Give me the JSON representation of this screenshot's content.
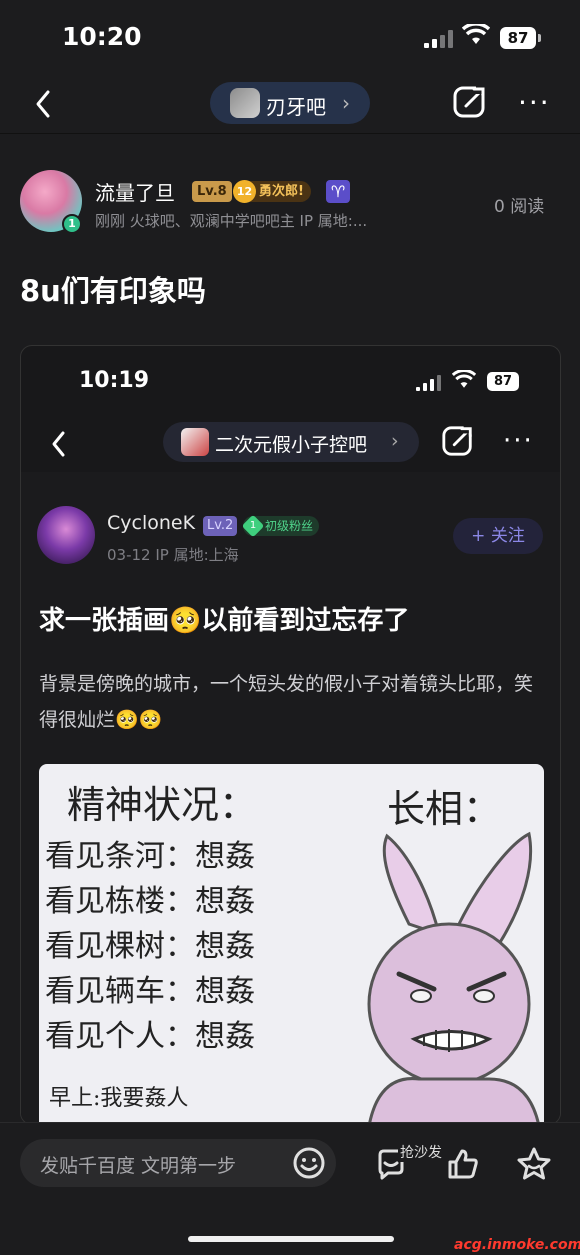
{
  "status_bar": {
    "time": "10:20",
    "battery": "87"
  },
  "nav": {
    "forum_name": "刃牙吧",
    "chevron": "›"
  },
  "author": {
    "name": "流量了旦",
    "level": "Lv.8",
    "title_num": "12",
    "title": "勇次郎!",
    "zodiac": "♈",
    "avatar_badge": "1",
    "meta": "刚刚   火球吧、观澜中学吧吧主   IP 属地:...",
    "read_count": "0 阅读"
  },
  "post": {
    "title": "8u们有印象吗"
  },
  "screenshot": {
    "time": "10:19",
    "battery": "87",
    "forum_name": "二次元假小子控吧",
    "chevron": "›",
    "user": {
      "name": "CycloneK",
      "level": "Lv.2",
      "fan_num": "1",
      "fan_label": "初级粉丝",
      "meta": "03-12   IP 属地:上海",
      "follow": "+ 关注"
    },
    "title": "求一张插画🥺以前看到过忘存了",
    "text": "背景是傍晚的城市，一个短头发的假小子对着镜头比耶，笑得很灿烂🥺🥺",
    "meme": {
      "left_title": "精神状况：",
      "right_title": "长相：",
      "lines": [
        "看见条河：想姦",
        "看见栋楼：想姦",
        "看见棵树：想姦",
        "看见辆车：想姦",
        "看见个人：想姦"
      ],
      "caption": "早上:我要姦人"
    }
  },
  "bottom_bar": {
    "compose_placeholder": "发贴千百度 文明第一步",
    "sofa_label": "抢沙发"
  },
  "watermark": "acg.inmoke.com"
}
